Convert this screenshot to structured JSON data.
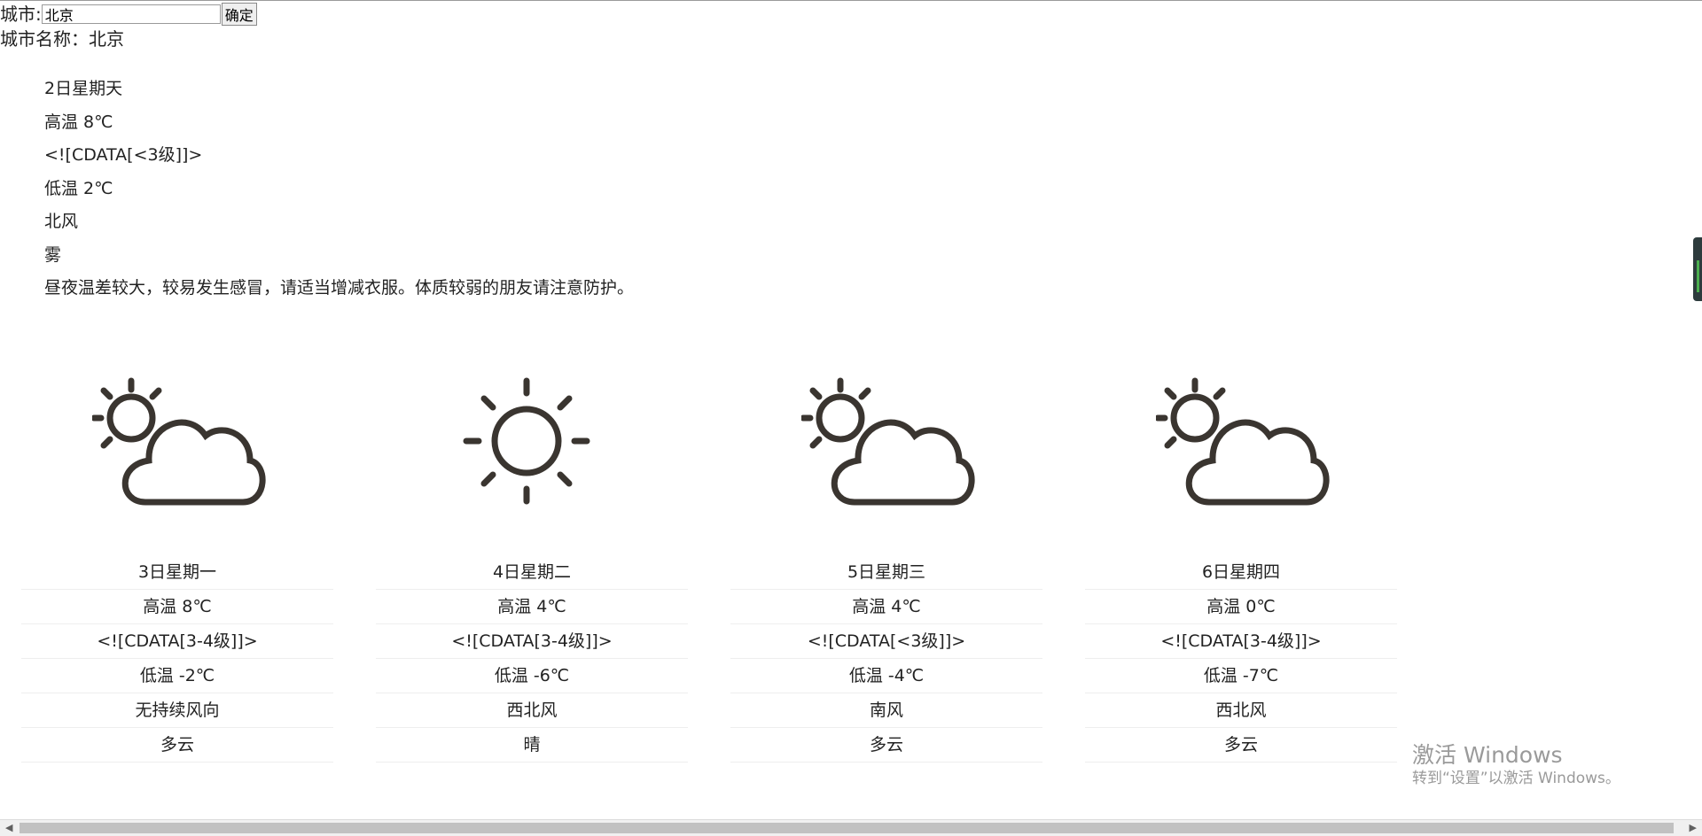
{
  "search": {
    "label": "城市:",
    "input_value": "北京",
    "button_label": "确定"
  },
  "city_name_line": "城市名称：北京",
  "today": {
    "date": "2日星期天",
    "high": "高温 8℃",
    "wind_power": "<![CDATA[<3级]]>",
    "low": "低温 2℃",
    "wind_direction": "北风",
    "weather": "雾",
    "advice": "昼夜温差较大，较易发生感冒，请适当增减衣服。体质较弱的朋友请注意防护。"
  },
  "forecast": [
    {
      "icon": "partly-cloudy-icon",
      "date": "3日星期一",
      "high": "高温 8℃",
      "wind_power": "<![CDATA[3-4级]]>",
      "low": "低温 -2℃",
      "wind_direction": "无持续风向",
      "weather": "多云"
    },
    {
      "icon": "sunny-icon",
      "date": "4日星期二",
      "high": "高温 4℃",
      "wind_power": "<![CDATA[3-4级]]>",
      "low": "低温 -6℃",
      "wind_direction": "西北风",
      "weather": "晴"
    },
    {
      "icon": "partly-cloudy-icon",
      "date": "5日星期三",
      "high": "高温 4℃",
      "wind_power": "<![CDATA[<3级]]>",
      "low": "低温 -4℃",
      "wind_direction": "南风",
      "weather": "多云"
    },
    {
      "icon": "partly-cloudy-icon",
      "date": "6日星期四",
      "high": "高温 0℃",
      "wind_power": "<![CDATA[3-4级]]>",
      "low": "低温 -7℃",
      "wind_direction": "西北风",
      "weather": "多云"
    }
  ],
  "watermark": {
    "line1": "激活 Windows",
    "line2": "转到“设置”以激活 Windows。"
  },
  "colors": {
    "icon_stroke": "#3a3530",
    "watermark": "#9a9a9a"
  }
}
